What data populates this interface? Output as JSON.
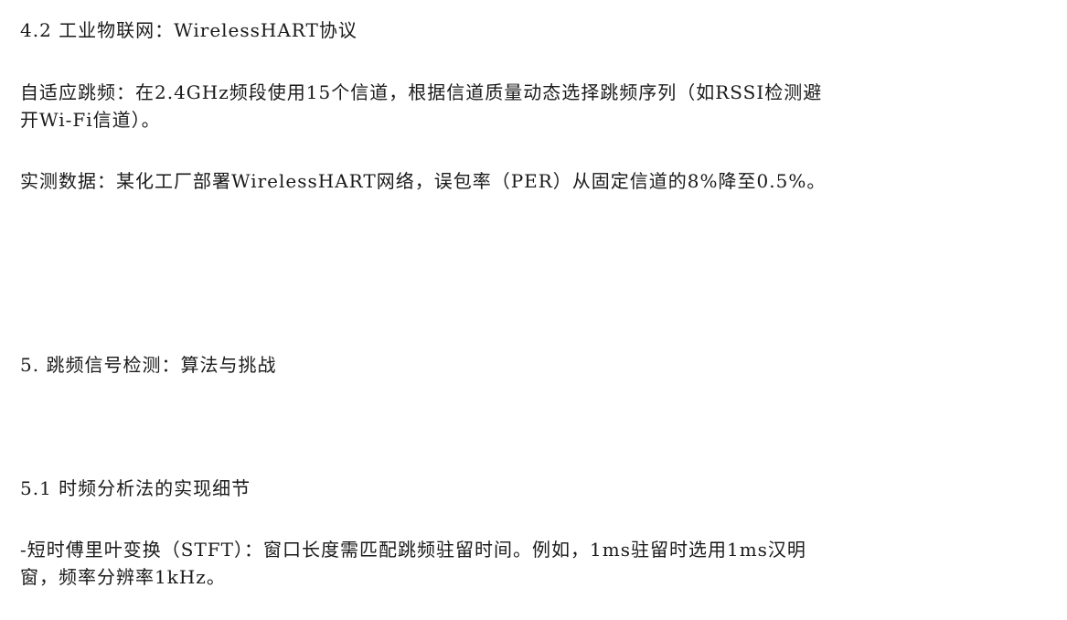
{
  "document": {
    "heading_4_2": "4.2 工业物联网：WirelessHART协议",
    "para_adaptive_hopping_line1": "自适应跳频：在2.4GHz频段使用15个信道，根据信道质量动态选择跳频序列（如RSSI检测避",
    "para_adaptive_hopping_line2": "开Wi-Fi信道）。",
    "para_measured_data": "实测数据：某化工厂部署WirelessHART网络，误包率（PER）从固定信道的8%降至0.5%。",
    "heading_5": "5. 跳频信号检测：算法与挑战",
    "heading_5_1": "5.1 时频分析法的实现细节",
    "para_stft_line1": "-短时傅里叶变换（STFT）：窗口长度需匹配跳频驻留时间。例如，1ms驻留时选用1ms汉明",
    "para_stft_line2": "窗，频率分辨率1kHz。"
  }
}
